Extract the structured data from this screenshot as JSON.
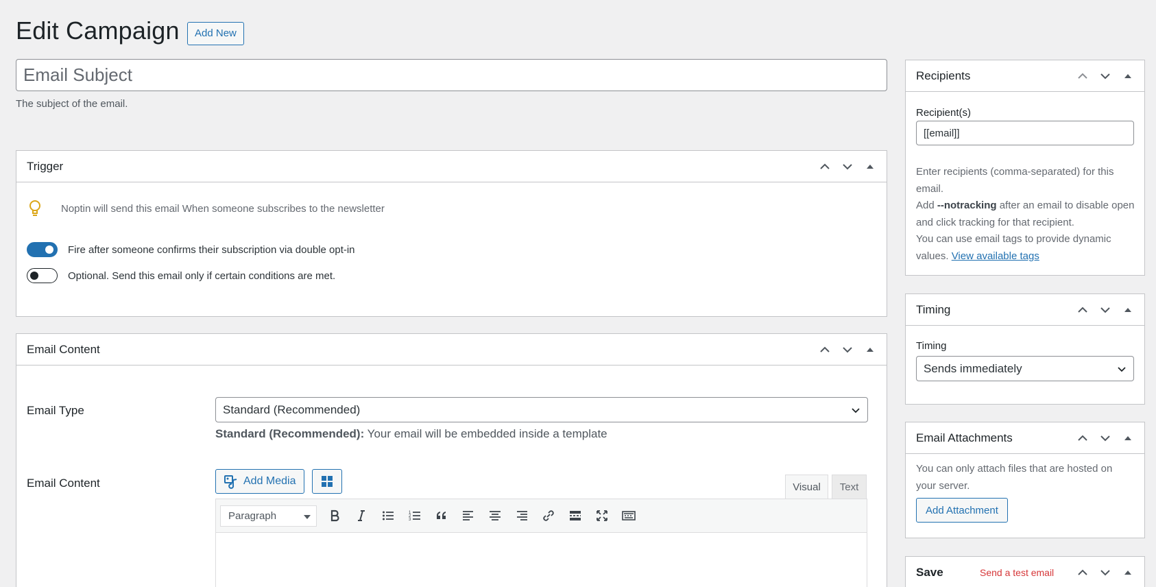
{
  "page": {
    "title": "Edit Campaign",
    "add_new_label": "Add New"
  },
  "subject": {
    "placeholder": "Email Subject",
    "value": "",
    "description": "The subject of the email."
  },
  "trigger": {
    "title": "Trigger",
    "tip_icon": "lightbulb-icon",
    "tip_text": "Noptin will send this email When someone subscribes to the newsletter",
    "toggles": [
      {
        "label": "Fire after someone confirms their subscription via double opt-in",
        "on": true
      },
      {
        "label": "Optional. Send this email only if certain conditions are met.",
        "on": false
      }
    ]
  },
  "email_content": {
    "title": "Email Content",
    "type_label": "Email Type",
    "type_value": "Standard (Recommended)",
    "type_desc_bold": "Standard (Recommended):",
    "type_desc_text": " Your email will be embedded inside a template",
    "content_label": "Email Content",
    "add_media_label": "Add Media",
    "tab_visual": "Visual",
    "tab_text": "Text",
    "format_value": "Paragraph",
    "toolbar_icons": [
      "bold-icon",
      "italic-icon",
      "bullet-list-icon",
      "numbered-list-icon",
      "blockquote-icon",
      "align-left-icon",
      "align-center-icon",
      "align-right-icon",
      "link-icon",
      "read-more-icon",
      "fullscreen-icon",
      "toolbar-toggle-icon"
    ]
  },
  "recipients": {
    "title": "Recipients",
    "field_label": "Recipient(s)",
    "value": "[[email]]",
    "help_1": "Enter recipients (comma-separated) for this email.",
    "help_2_prefix": "Add ",
    "help_2_bold": "--notracking",
    "help_2_suffix": " after an email to disable open and click tracking for that recipient.",
    "help_3": "You can use email tags to provide dynamic values. ",
    "help_link": "View available tags"
  },
  "timing": {
    "title": "Timing",
    "field_label": "Timing",
    "value": "Sends immediately"
  },
  "attachments": {
    "title": "Email Attachments",
    "help": "You can only attach files that are hosted on your server.",
    "button_label": "Add Attachment"
  },
  "save": {
    "title": "Save",
    "test_link": "Send a test email"
  },
  "colors": {
    "accent": "#2271b1",
    "danger": "#d63638",
    "bulb": "#dba617"
  }
}
